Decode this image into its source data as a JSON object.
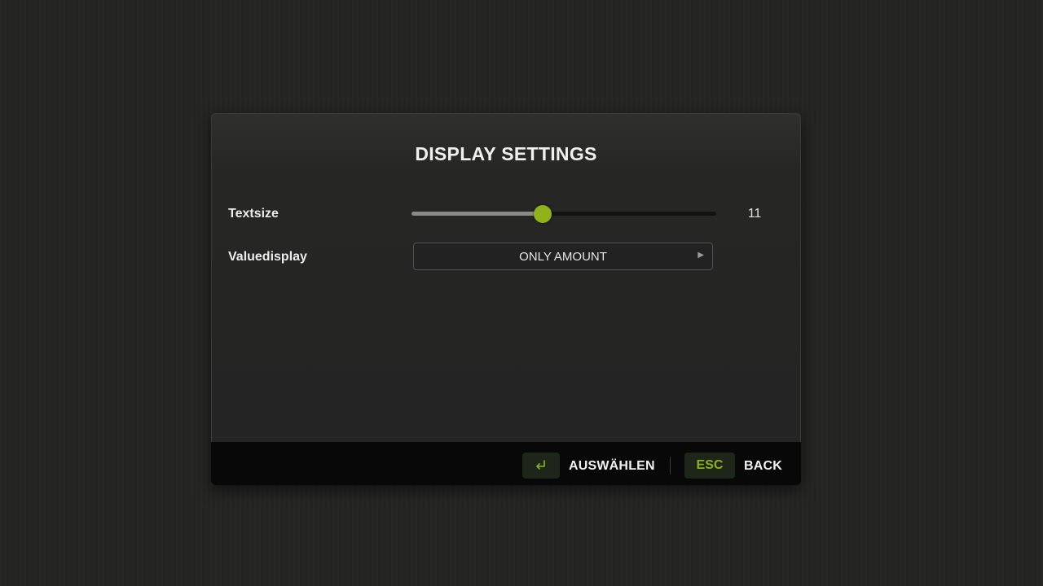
{
  "dialog": {
    "title": "DISPLAY SETTINGS"
  },
  "settings": [
    {
      "label": "Textsize",
      "control": "slider",
      "value": "11",
      "fill_fraction": 0.43
    },
    {
      "label": "Valuedisplay",
      "control": "selector",
      "value": "ONLY AMOUNT",
      "arrow_icon": "triangle-right-icon"
    }
  ],
  "footer": {
    "actions": [
      {
        "key_icon": "enter-key-icon",
        "key_label": "",
        "label": "AUSWÄHLEN"
      },
      {
        "key_icon": "",
        "key_label": "ESC",
        "label": "BACK"
      }
    ]
  },
  "colors": {
    "accent": "#8fb219",
    "background": "#242423",
    "panel": "#262625",
    "footer": "#080808"
  }
}
